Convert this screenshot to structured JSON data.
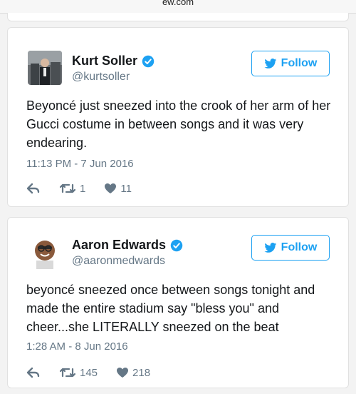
{
  "browser": {
    "domain": "ew.com"
  },
  "tweets": [
    {
      "name": "Kurt Soller",
      "handle": "@kurtsoller",
      "follow_label": "Follow",
      "text": "Beyoncé just sneezed into the crook of her arm of her Gucci costume in between songs and it was very endearing.",
      "time": "11:13 PM - 7 Jun 2016",
      "retweets": "1",
      "likes": "11"
    },
    {
      "name": "Aaron Edwards",
      "handle": "@aaronmedwards",
      "follow_label": "Follow",
      "text": "beyoncé sneezed once between songs tonight and made the entire stadium say \"bless you\" and cheer...she LITERALLY sneezed on the beat",
      "time": "1:28 AM - 8 Jun 2016",
      "retweets": "145",
      "likes": "218"
    }
  ],
  "colors": {
    "twitter_blue": "#1da1f2",
    "muted": "#657786",
    "text": "#14171a"
  },
  "icons": [
    "verified-icon",
    "twitter-bird-icon",
    "reply-icon",
    "retweet-icon",
    "heart-icon"
  ]
}
